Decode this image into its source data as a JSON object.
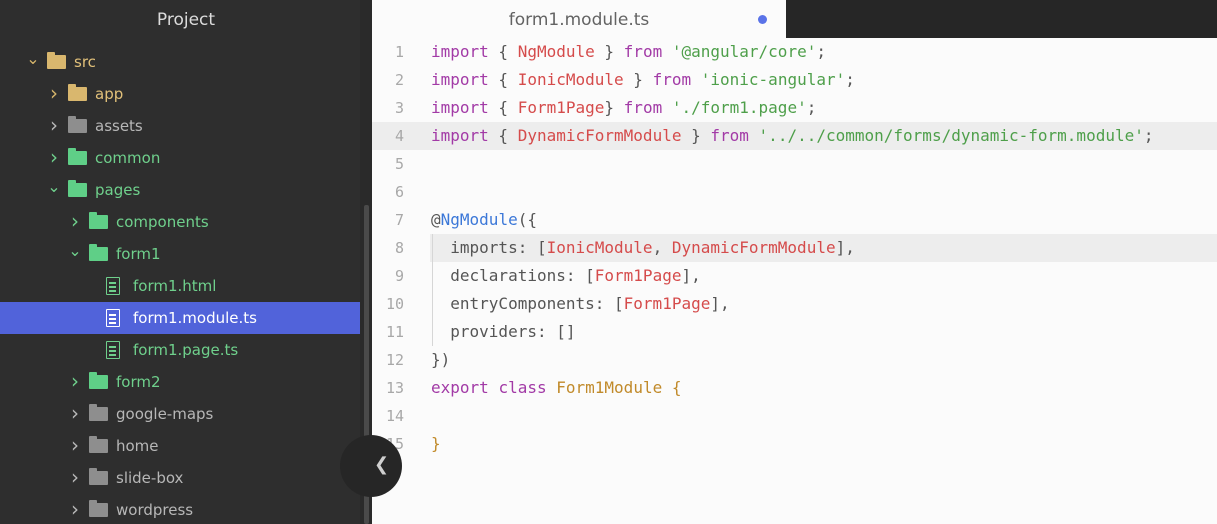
{
  "sidebar": {
    "title": "Project",
    "tree": [
      {
        "label": "src",
        "depth": 0,
        "expanded": true,
        "type": "folder",
        "color": "yellow"
      },
      {
        "label": "app",
        "depth": 1,
        "expanded": false,
        "type": "folder",
        "color": "yellow"
      },
      {
        "label": "assets",
        "depth": 1,
        "expanded": false,
        "type": "folder",
        "color": "gray"
      },
      {
        "label": "common",
        "depth": 1,
        "expanded": false,
        "type": "folder",
        "color": "green"
      },
      {
        "label": "pages",
        "depth": 1,
        "expanded": true,
        "type": "folder",
        "color": "green"
      },
      {
        "label": "components",
        "depth": 2,
        "expanded": false,
        "type": "folder",
        "color": "green"
      },
      {
        "label": "form1",
        "depth": 2,
        "expanded": true,
        "type": "folder",
        "color": "green"
      },
      {
        "label": "form1.html",
        "depth": 3,
        "type": "file",
        "color": "green"
      },
      {
        "label": "form1.module.ts",
        "depth": 3,
        "type": "file",
        "color": "green",
        "selected": true
      },
      {
        "label": "form1.page.ts",
        "depth": 3,
        "type": "file",
        "color": "green"
      },
      {
        "label": "form2",
        "depth": 2,
        "expanded": false,
        "type": "folder",
        "color": "green"
      },
      {
        "label": "google-maps",
        "depth": 2,
        "expanded": false,
        "type": "folder",
        "color": "gray"
      },
      {
        "label": "home",
        "depth": 2,
        "expanded": false,
        "type": "folder",
        "color": "gray"
      },
      {
        "label": "slide-box",
        "depth": 2,
        "expanded": false,
        "type": "folder",
        "color": "gray"
      },
      {
        "label": "wordpress",
        "depth": 2,
        "expanded": false,
        "type": "folder",
        "color": "gray"
      }
    ]
  },
  "tabs": [
    {
      "label": "form1.module.ts",
      "active": true,
      "modified": true
    }
  ],
  "editor": {
    "line_numbers": [
      "1",
      "2",
      "3",
      "4",
      "5",
      "6",
      "7",
      "8",
      "9",
      "10",
      "11",
      "12",
      "13",
      "14",
      "15"
    ],
    "lines": [
      [
        [
          "kw",
          "import"
        ],
        [
          "pl",
          " { "
        ],
        [
          "cls",
          "NgModule"
        ],
        [
          "pl",
          " } "
        ],
        [
          "kw",
          "from"
        ],
        [
          "pl",
          " "
        ],
        [
          "str",
          "'@angular/core'"
        ],
        [
          "pl",
          ";"
        ]
      ],
      [
        [
          "kw",
          "import"
        ],
        [
          "pl",
          " { "
        ],
        [
          "cls",
          "IonicModule"
        ],
        [
          "pl",
          " } "
        ],
        [
          "kw",
          "from"
        ],
        [
          "pl",
          " "
        ],
        [
          "str",
          "'ionic-angular'"
        ],
        [
          "pl",
          ";"
        ]
      ],
      [
        [
          "kw",
          "import"
        ],
        [
          "pl",
          " { "
        ],
        [
          "cls",
          "Form1Page"
        ],
        [
          "pl",
          "} "
        ],
        [
          "kw",
          "from"
        ],
        [
          "pl",
          " "
        ],
        [
          "str",
          "'./form1.page'"
        ],
        [
          "pl",
          ";"
        ]
      ],
      [
        [
          "kw",
          "import"
        ],
        [
          "pl",
          " { "
        ],
        [
          "cls",
          "DynamicFormModule"
        ],
        [
          "pl",
          " } "
        ],
        [
          "kw",
          "from"
        ],
        [
          "pl",
          " "
        ],
        [
          "str",
          "'../../common/forms/dynamic-form.module'"
        ],
        [
          "pl",
          ";"
        ]
      ],
      [],
      [],
      [
        [
          "pl",
          "@"
        ],
        [
          "dec",
          "NgModule"
        ],
        [
          "pl",
          "({"
        ]
      ],
      [
        [
          "pl",
          "  imports: ["
        ],
        [
          "cls",
          "IonicModule"
        ],
        [
          "pl",
          ", "
        ],
        [
          "cls",
          "DynamicFormModule"
        ],
        [
          "pl",
          "],"
        ]
      ],
      [
        [
          "pl",
          "  declarations: ["
        ],
        [
          "cls",
          "Form1Page"
        ],
        [
          "pl",
          "],"
        ]
      ],
      [
        [
          "pl",
          "  entryComponents: ["
        ],
        [
          "cls",
          "Form1Page"
        ],
        [
          "pl",
          "],"
        ]
      ],
      [
        [
          "pl",
          "  providers: []"
        ]
      ],
      [
        [
          "pl",
          "})"
        ]
      ],
      [
        [
          "kw",
          "export"
        ],
        [
          "pl",
          " "
        ],
        [
          "kw",
          "class"
        ],
        [
          "pl",
          " "
        ],
        [
          "gold",
          "Form1Module {"
        ]
      ],
      [],
      [
        [
          "gold",
          "}"
        ]
      ]
    ]
  },
  "collapse_toggle_icon": "chevron-left-icon"
}
